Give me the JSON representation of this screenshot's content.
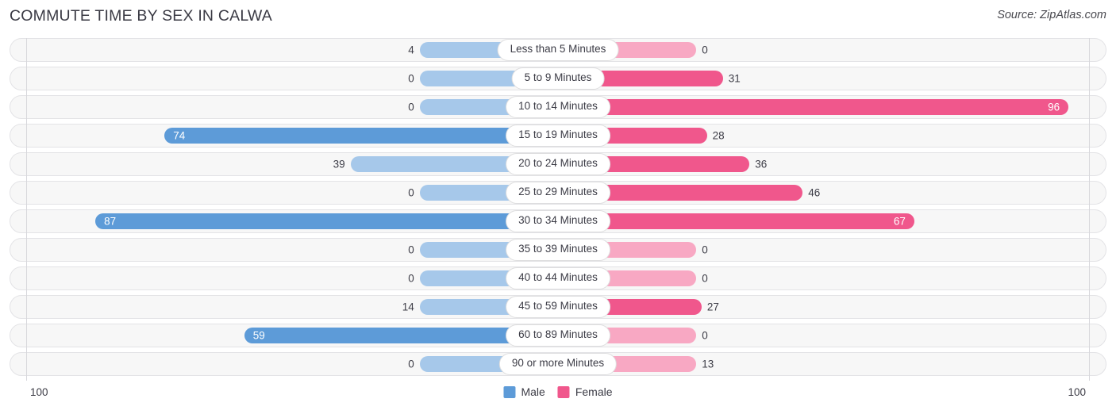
{
  "header": {
    "title": "COMMUTE TIME BY SEX IN CALWA",
    "source": "Source: ZipAtlas.com"
  },
  "axis": {
    "left_max_label": "100",
    "right_max_label": "100"
  },
  "legend": {
    "items": [
      {
        "label": "Male",
        "color": "#5d9bd8",
        "icon": "square-swatch-icon"
      },
      {
        "label": "Female",
        "color": "#f0578c",
        "icon": "square-swatch-icon"
      }
    ]
  },
  "chart_data": {
    "type": "bar",
    "subtype": "diverging-horizontal-bar",
    "title": "COMMUTE TIME BY SEX IN CALWA",
    "xlabel": "",
    "ylabel": "",
    "xlim": [
      0,
      100
    ],
    "grid": false,
    "legend_position": "bottom-center",
    "categories": [
      "Less than 5 Minutes",
      "5 to 9 Minutes",
      "10 to 14 Minutes",
      "15 to 19 Minutes",
      "20 to 24 Minutes",
      "25 to 29 Minutes",
      "30 to 34 Minutes",
      "35 to 39 Minutes",
      "40 to 44 Minutes",
      "45 to 59 Minutes",
      "60 to 89 Minutes",
      "90 or more Minutes"
    ],
    "series": [
      {
        "name": "Male",
        "direction": "left",
        "color": "#5d9bd8",
        "light_color": "#a6c8ea",
        "values": [
          4,
          0,
          0,
          74,
          39,
          0,
          87,
          0,
          0,
          14,
          59,
          0
        ]
      },
      {
        "name": "Female",
        "direction": "right",
        "color": "#f0578c",
        "light_color": "#f8a8c3",
        "values": [
          0,
          31,
          96,
          28,
          36,
          46,
          67,
          0,
          0,
          27,
          0,
          13
        ]
      }
    ]
  },
  "rows": [
    {
      "label": "Less than 5 Minutes",
      "male": "4",
      "female": "0"
    },
    {
      "label": "5 to 9 Minutes",
      "male": "0",
      "female": "31"
    },
    {
      "label": "10 to 14 Minutes",
      "male": "0",
      "female": "96"
    },
    {
      "label": "15 to 19 Minutes",
      "male": "74",
      "female": "28"
    },
    {
      "label": "20 to 24 Minutes",
      "male": "39",
      "female": "36"
    },
    {
      "label": "25 to 29 Minutes",
      "male": "0",
      "female": "46"
    },
    {
      "label": "30 to 34 Minutes",
      "male": "87",
      "female": "67"
    },
    {
      "label": "35 to 39 Minutes",
      "male": "0",
      "female": "0"
    },
    {
      "label": "40 to 44 Minutes",
      "male": "0",
      "female": "0"
    },
    {
      "label": "45 to 59 Minutes",
      "male": "14",
      "female": "27"
    },
    {
      "label": "60 to 89 Minutes",
      "male": "59",
      "female": "0"
    },
    {
      "label": "90 or more Minutes",
      "male": "0",
      "female": "13"
    }
  ]
}
